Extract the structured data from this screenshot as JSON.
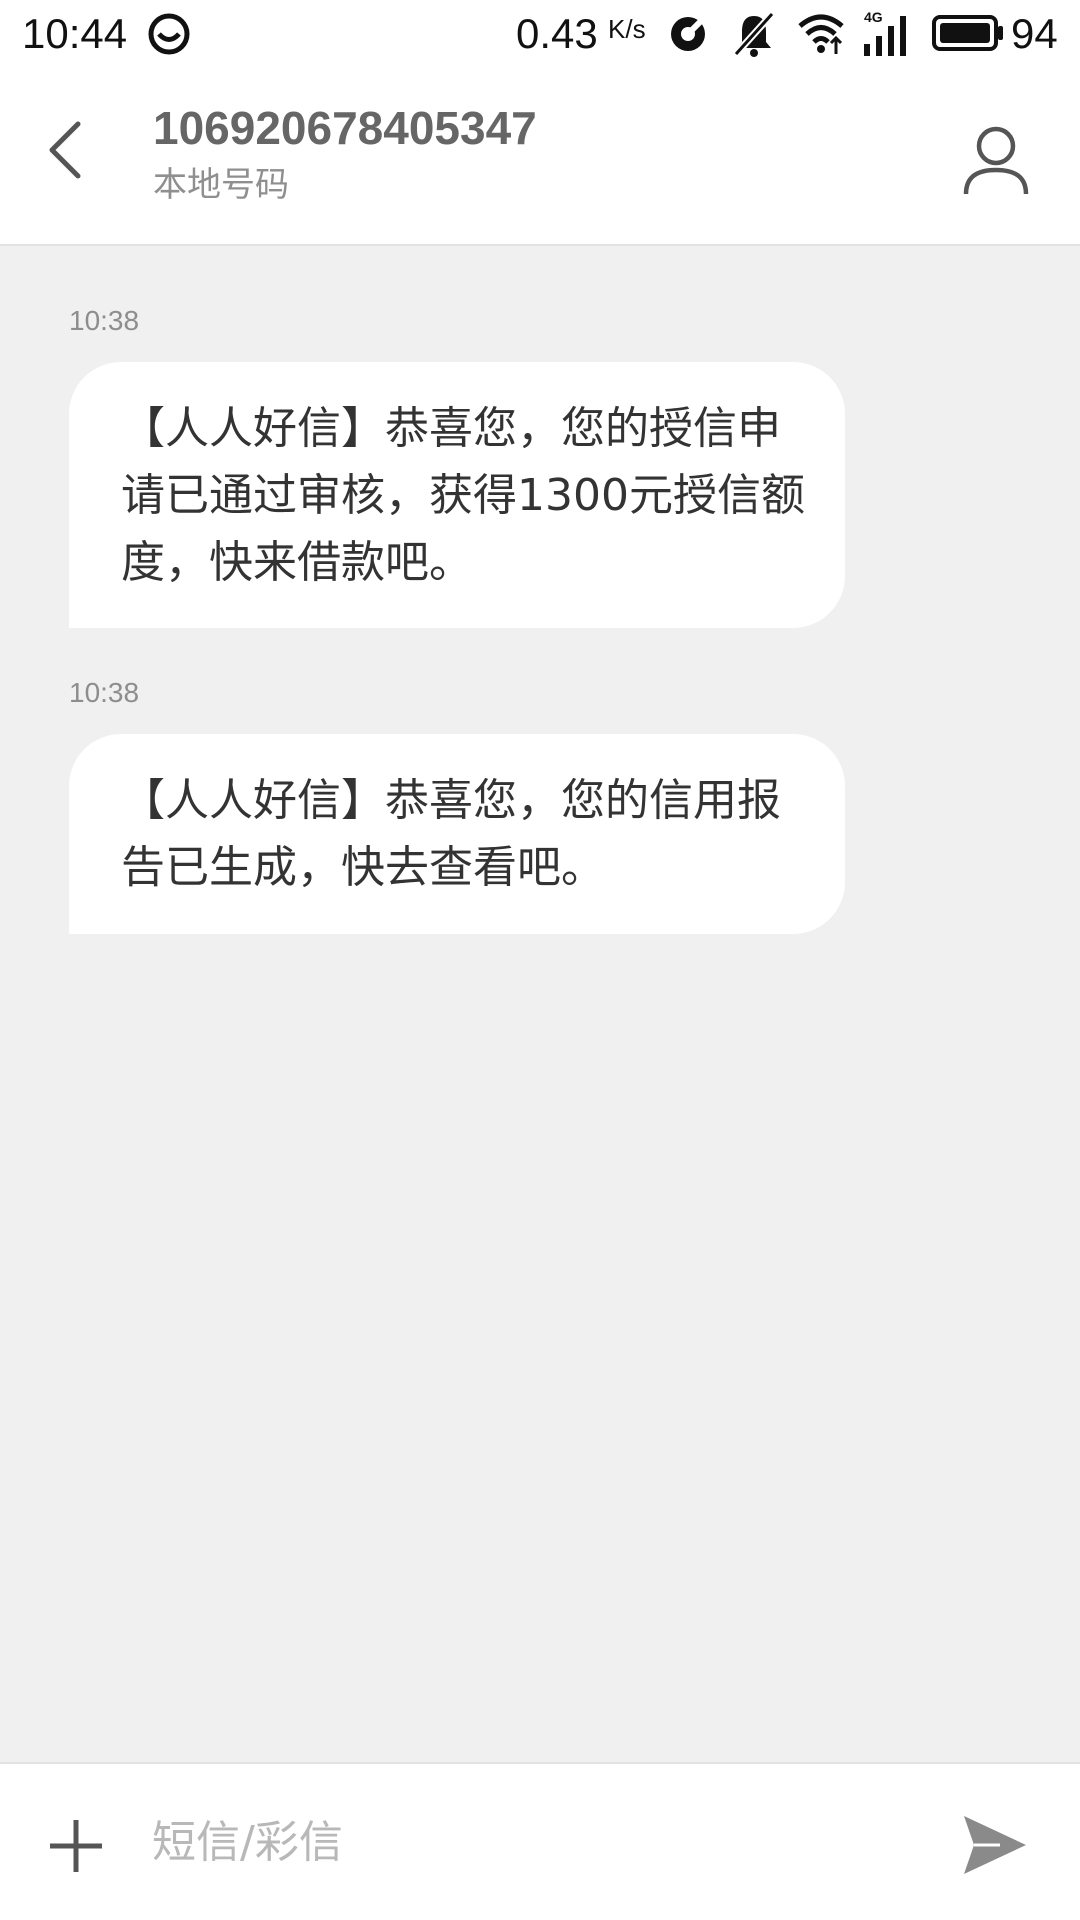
{
  "status_bar": {
    "time": "10:44",
    "net_speed": "0.43",
    "net_speed_unit": "K/s",
    "network_type": "4G",
    "battery_level": "94",
    "icons": [
      "app-notification-icon",
      "hotspot-icon",
      "mute-icon",
      "wifi-icon",
      "signal-icon",
      "battery-icon"
    ]
  },
  "header": {
    "contact_number": "106920678405347",
    "contact_subtitle": "本地号码",
    "icons": [
      "back-arrow-icon",
      "contact-person-icon"
    ]
  },
  "messages": [
    {
      "time": "10:38",
      "text": "【人人好信】恭喜您，您的授信申请已通过审核，获得1300元授信额度，快来借款吧。"
    },
    {
      "time": "10:38",
      "text": "【人人好信】恭喜您，您的信用报告已生成，快去查看吧。"
    }
  ],
  "composer": {
    "placeholder": "短信/彩信",
    "value": "",
    "icons": [
      "plus-icon",
      "send-icon"
    ]
  },
  "colors": {
    "background": "#f0f0f0",
    "bubble": "#ffffff",
    "primary_text": "#333333",
    "secondary_text": "#8f8f8f",
    "icon_gray": "#555555"
  }
}
